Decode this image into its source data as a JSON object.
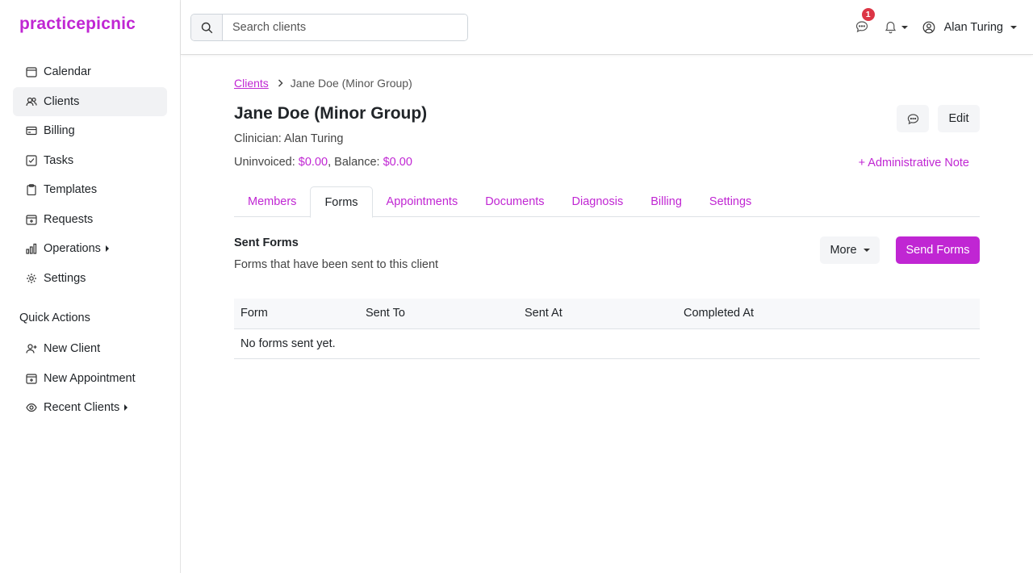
{
  "app": {
    "logo": "practicepicnic"
  },
  "sidebar": {
    "items": [
      {
        "label": "Calendar",
        "icon": "calendar-icon"
      },
      {
        "label": "Clients",
        "icon": "users-icon",
        "active": true
      },
      {
        "label": "Billing",
        "icon": "credit-card-icon"
      },
      {
        "label": "Tasks",
        "icon": "checkbox-icon"
      },
      {
        "label": "Templates",
        "icon": "clipboard-icon"
      },
      {
        "label": "Requests",
        "icon": "calendar-plus-icon"
      },
      {
        "label": "Operations",
        "icon": "bar-chart-icon"
      },
      {
        "label": "Settings",
        "icon": "gear-icon"
      }
    ],
    "quick_actions_title": "Quick Actions",
    "quick_actions": [
      {
        "label": "New Client",
        "icon": "user-plus-icon"
      },
      {
        "label": "New Appointment",
        "icon": "calendar-plus-icon"
      },
      {
        "label": "Recent Clients",
        "icon": "eye-icon"
      }
    ]
  },
  "topbar": {
    "search_placeholder": "Search clients",
    "message_count": "1",
    "user_name": "Alan Turing"
  },
  "breadcrumb": {
    "parent": "Clients",
    "current": "Jane Doe (Minor Group)"
  },
  "client": {
    "name": "Jane Doe (Minor Group)",
    "clinician": "Clinician: Alan Turing",
    "uninvoiced_label": "Uninvoiced: ",
    "uninvoiced": "$0.00",
    "balance_label": ", Balance: ",
    "balance": "$0.00"
  },
  "actions": {
    "edit": "Edit",
    "admin_note": "+ Administrative Note"
  },
  "tabs": [
    "Members",
    "Forms",
    "Appointments",
    "Documents",
    "Diagnosis",
    "Billing",
    "Settings"
  ],
  "active_tab": "Forms",
  "forms": {
    "title": "Sent Forms",
    "subtitle": "Forms that have been sent to this client",
    "more_label": "More",
    "send_label": "Send Forms",
    "columns": [
      "Form",
      "Sent To",
      "Sent At",
      "Completed At"
    ],
    "empty": "No forms sent yet."
  },
  "colors": {
    "brand": "#c026d3",
    "badge": "#dc3545"
  }
}
